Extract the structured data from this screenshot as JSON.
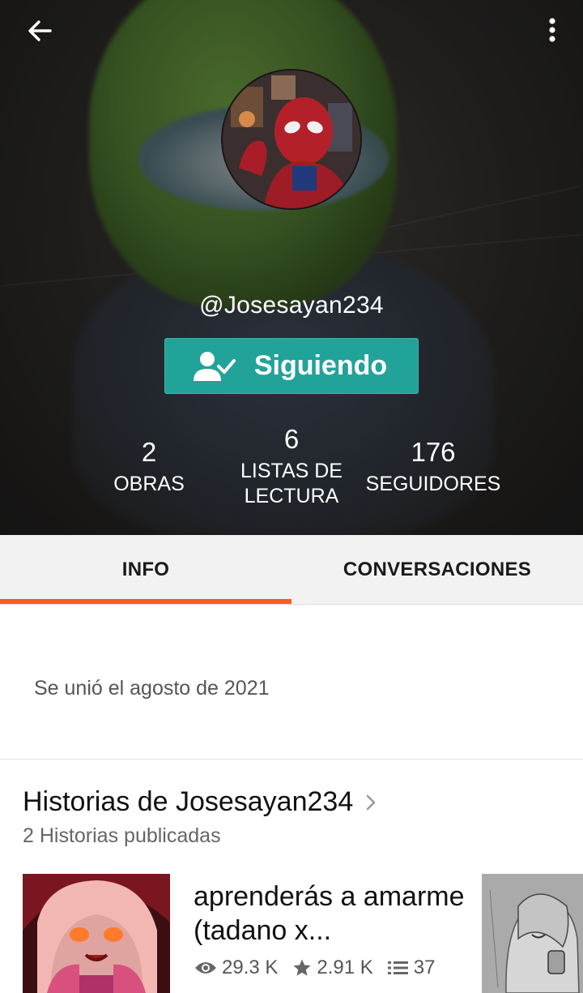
{
  "header": {
    "username": "@Josesayan234",
    "follow_label": "Siguiendo",
    "colors": {
      "accent": "#22a39a",
      "tab_indicator": "#ff5a1f"
    }
  },
  "stats": [
    {
      "value": "2",
      "label": "OBRAS"
    },
    {
      "value": "6",
      "label": "LISTAS DE LECTURA"
    },
    {
      "value": "176",
      "label": "SEGUIDORES"
    }
  ],
  "tabs": [
    {
      "label": "INFO",
      "active": true
    },
    {
      "label": "CONVERSACIONES",
      "active": false
    }
  ],
  "info": {
    "joined": "Se unió el agosto de 2021"
  },
  "stories": {
    "title": "Historias de Josesayan234",
    "subtitle": "2 Historias publicadas",
    "items": [
      {
        "title": "aprenderás a amarme (tadano x...",
        "reads": "29.3 K",
        "votes": "2.91 K",
        "parts": "37"
      }
    ]
  },
  "icons": [
    "back-arrow-icon",
    "more-vert-icon",
    "follow-check-icon",
    "chevron-right-icon",
    "eye-icon",
    "star-icon",
    "list-icon"
  ]
}
